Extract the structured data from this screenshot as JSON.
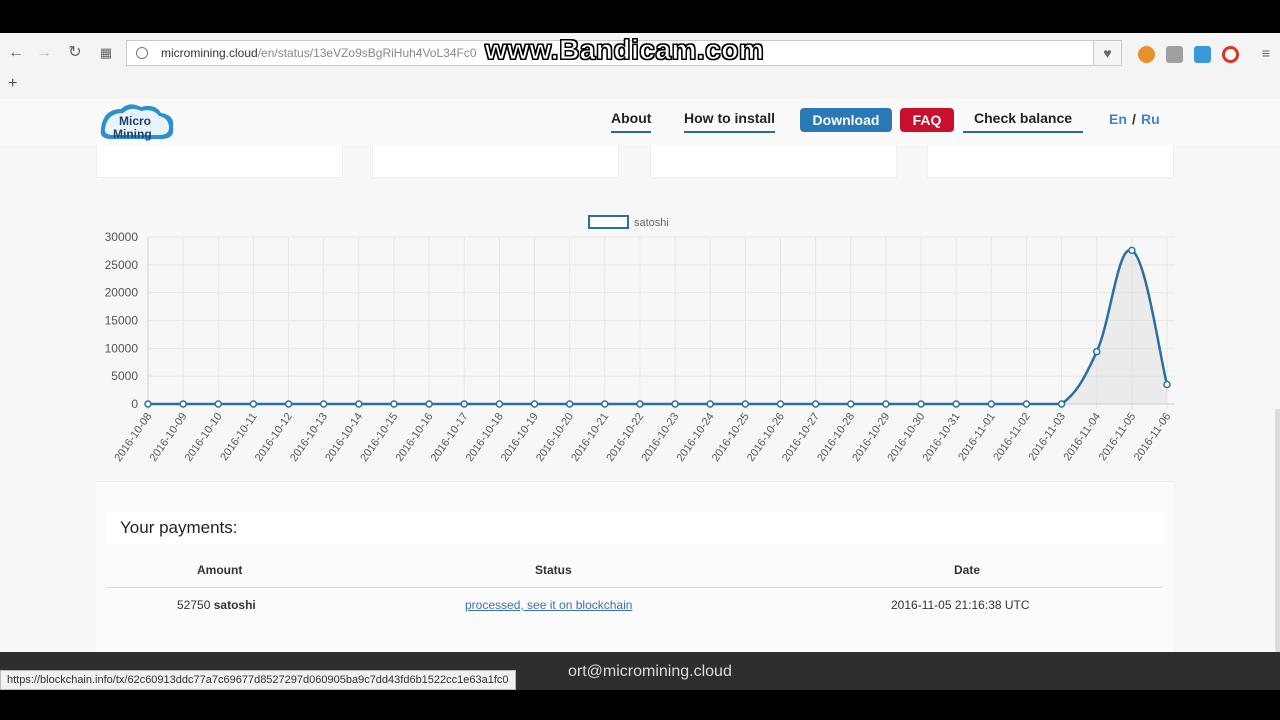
{
  "browser": {
    "url_host": "micromining.cloud",
    "url_path": "/en/status/13eVZo9sBgRiHuh4VoL34Fc0",
    "watermark": "www.Bandicam.com",
    "new_tab": "+"
  },
  "nav": {
    "logo_line1": "Micro",
    "logo_line2": "Mining",
    "about": "About",
    "how_to_install": "How to install",
    "download": "Download",
    "faq": "FAQ",
    "check_balance": "Check balance",
    "lang_en": "En",
    "lang_sep": "/",
    "lang_ru": "Ru"
  },
  "colors": {
    "download_bg": "#2a78b5",
    "faq_bg": "#c8102e",
    "line": "#2b6fa3",
    "fill": "rgba(220,220,220,0.45)"
  },
  "chart_data": {
    "type": "line",
    "legend": "satoshi",
    "legend_position": "top",
    "ylim": [
      0,
      30000
    ],
    "yticks": [
      0,
      5000,
      10000,
      15000,
      20000,
      25000,
      30000
    ],
    "grid": true,
    "categories": [
      "2016-10-08",
      "2016-10-09",
      "2016-10-10",
      "2016-10-11",
      "2016-10-12",
      "2016-10-13",
      "2016-10-14",
      "2016-10-15",
      "2016-10-16",
      "2016-10-17",
      "2016-10-18",
      "2016-10-19",
      "2016-10-20",
      "2016-10-21",
      "2016-10-22",
      "2016-10-23",
      "2016-10-24",
      "2016-10-25",
      "2016-10-26",
      "2016-10-27",
      "2016-10-28",
      "2016-10-29",
      "2016-10-30",
      "2016-10-31",
      "2016-11-01",
      "2016-11-02",
      "2016-11-03",
      "2016-11-04",
      "2016-11-05",
      "2016-11-06"
    ],
    "series": [
      {
        "name": "satoshi",
        "values": [
          0,
          0,
          0,
          0,
          0,
          0,
          0,
          0,
          0,
          0,
          0,
          0,
          0,
          0,
          0,
          0,
          0,
          0,
          0,
          0,
          0,
          0,
          0,
          0,
          0,
          0,
          0,
          9400,
          27600,
          3500
        ]
      }
    ]
  },
  "payments": {
    "title": "Your payments:",
    "headers": {
      "amount": "Amount",
      "status": "Status",
      "date": "Date"
    },
    "rows": [
      {
        "amount": "52750",
        "unit": "satoshi",
        "status": "processed, see it on blockchain",
        "date": "2016-11-05 21:16:38 UTC"
      }
    ]
  },
  "footer": {
    "email_text": "ort@micromining.cloud"
  },
  "statusbar": {
    "hover_url": "https://blockchain.info/tx/62c60913ddc77a7c69677d8527297d060905ba9c7dd43fd6b1522cc1e63a1fc0"
  }
}
